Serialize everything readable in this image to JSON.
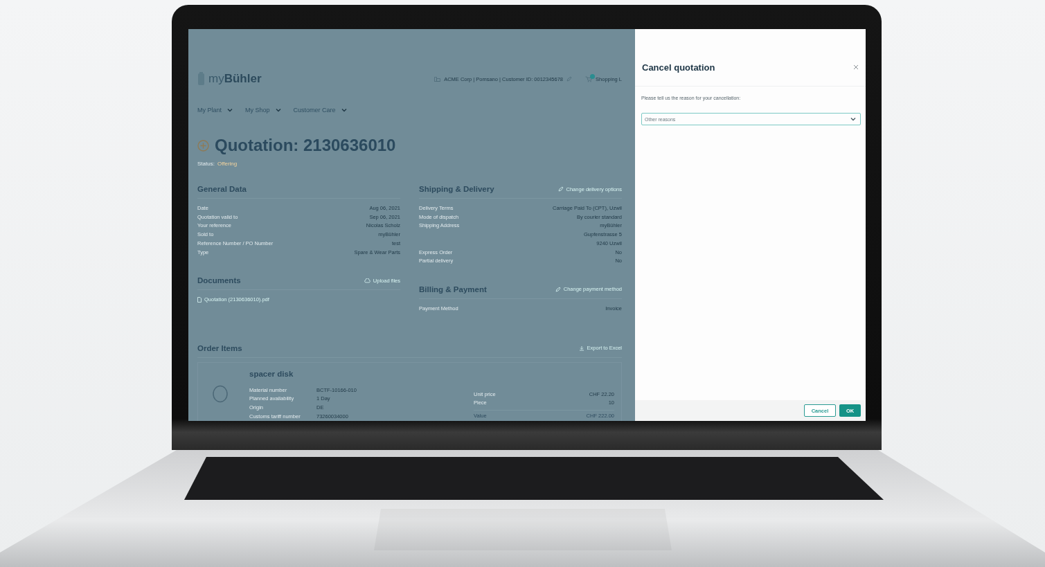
{
  "header": {
    "logo": "myBühler",
    "account": "ACME Corp | Pomsano | Customer ID: 0012345678",
    "shopping": "Shopping L"
  },
  "nav": [
    {
      "label": "My Plant"
    },
    {
      "label": "My Shop"
    },
    {
      "label": "Customer Care"
    }
  ],
  "title": "Quotation: 2130636010",
  "status_label": "Status:",
  "status": "Offering",
  "general_data": {
    "title": "General Data",
    "rows": [
      {
        "label": "Date",
        "lines": [
          "Aug 06, 2021"
        ]
      },
      {
        "label": "Quotation valid to",
        "lines": [
          "Sep 06, 2021"
        ]
      },
      {
        "label": "Your reference",
        "lines": [
          "Nicolas Scholz"
        ]
      },
      {
        "label": "Sold to",
        "lines": [
          "myBühler"
        ]
      },
      {
        "label": "Reference Number / PO Number",
        "lines": [
          "test"
        ]
      },
      {
        "label": "Type",
        "lines": [
          "Spare & Wear Parts"
        ]
      }
    ]
  },
  "documents": {
    "title": "Documents",
    "action": "Upload files",
    "files": [
      "Quotation (2130636010).pdf"
    ]
  },
  "shipping": {
    "title": "Shipping & Delivery",
    "action": "Change delivery options",
    "rows": [
      {
        "label": "Delivery Terms",
        "lines": [
          "Carriage Paid To (CPT), Uzwil"
        ]
      },
      {
        "label": "Mode of dispatch",
        "lines": [
          "By courier standard"
        ]
      },
      {
        "label": "Shipping Address",
        "lines": [
          "myBühler",
          "Gupfenstrasse 5",
          "9240 Uzwil"
        ]
      },
      {
        "label": "Express Order",
        "lines": [
          "No"
        ]
      },
      {
        "label": "Partial delivery",
        "lines": [
          "No"
        ]
      }
    ]
  },
  "billing": {
    "title": "Billing & Payment",
    "action": "Change payment method",
    "rows": [
      {
        "label": "Payment Method",
        "lines": [
          "Invoice"
        ]
      }
    ]
  },
  "order_items": {
    "title": "Order Items",
    "action": "Export to Excel",
    "items": [
      {
        "name": "spacer disk",
        "details": [
          {
            "label": "Material number",
            "value": "BCTF-10166-010"
          },
          {
            "label": "Planned availability",
            "value": "1 Day"
          },
          {
            "label": "Origin",
            "value": "DE"
          },
          {
            "label": "Customs tariff number",
            "value": "73260034000"
          }
        ],
        "pricing": [
          {
            "label": "Unit price",
            "value": "CHF 22.20"
          },
          {
            "label": "Piece",
            "value": "10"
          }
        ],
        "total": {
          "label": "Value",
          "value": "CHF 222.00"
        }
      }
    ]
  },
  "dialog": {
    "title": "Cancel quotation",
    "prompt": "Please tell us the reason for your cancellation:",
    "reason": "Other reasons",
    "buttons": [
      {
        "label": "Cancel",
        "kind": "secondary"
      },
      {
        "label": "OK",
        "kind": "primary"
      }
    ]
  }
}
